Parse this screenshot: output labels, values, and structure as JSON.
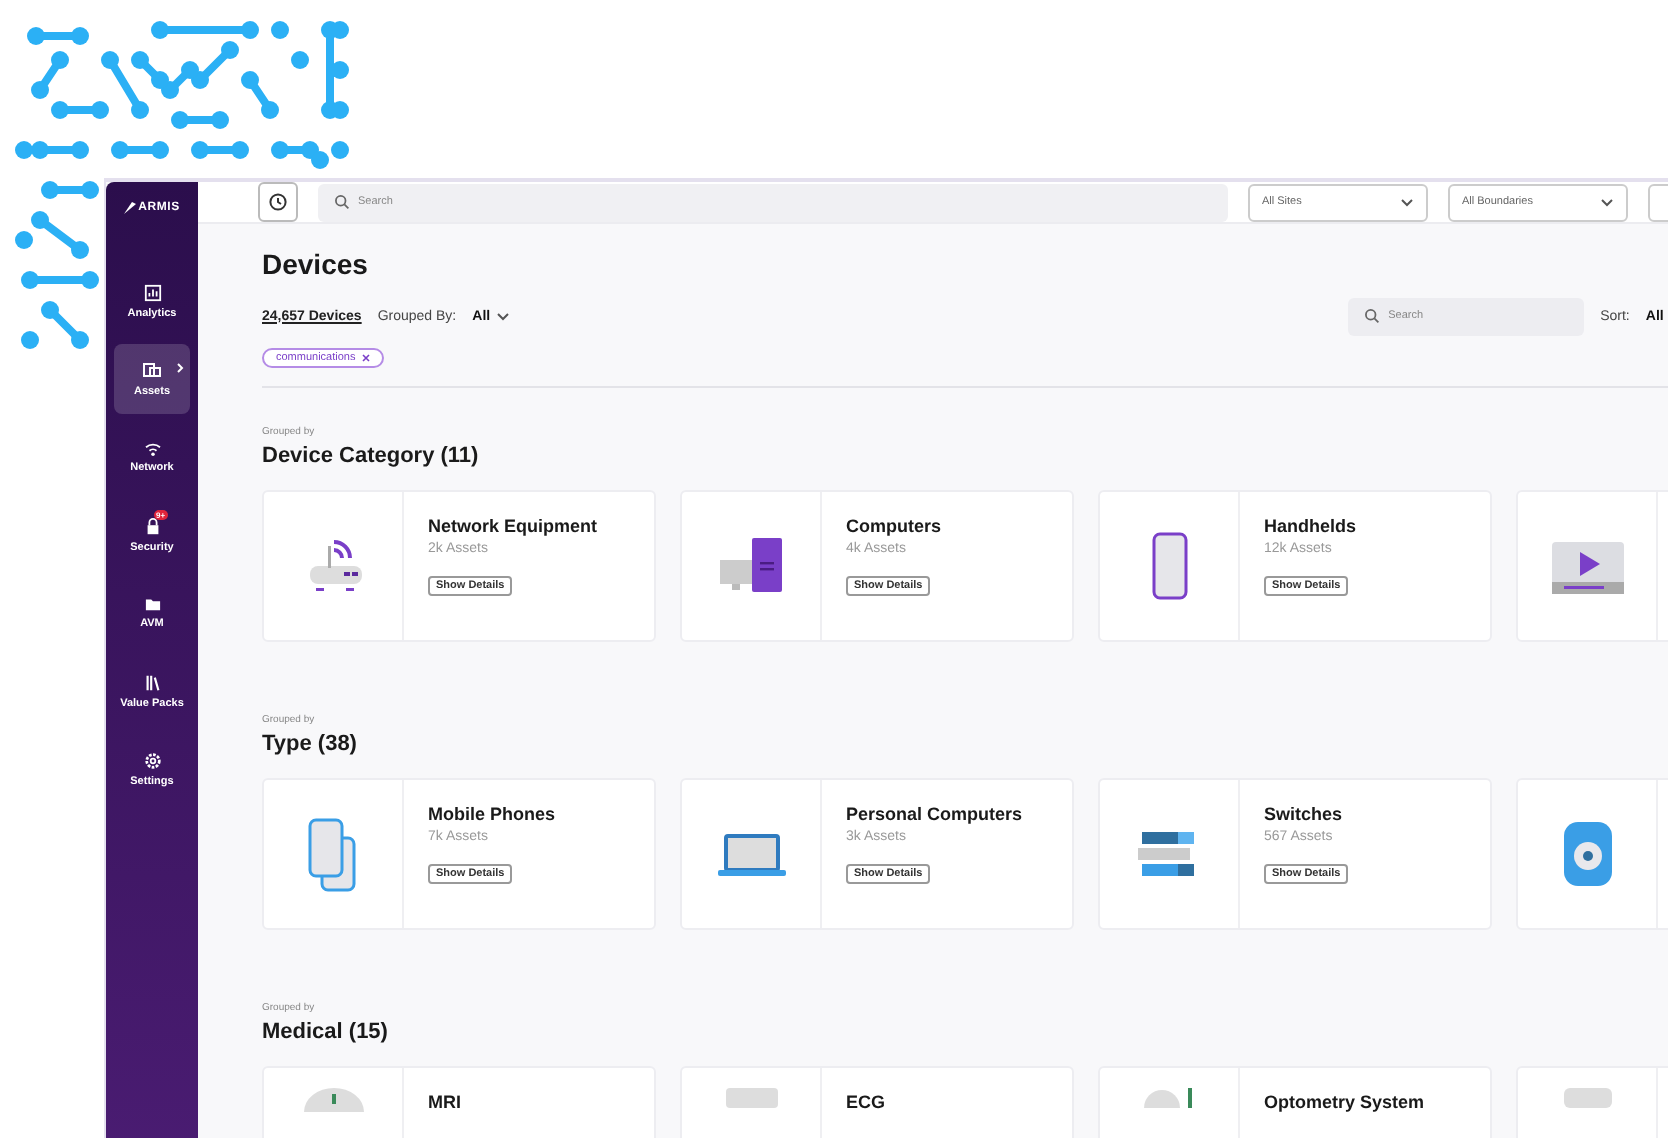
{
  "sidebar": {
    "logo": "ARMIS",
    "items": [
      {
        "label": "Analytics",
        "selected": false
      },
      {
        "label": "Assets",
        "selected": true,
        "expandable": true
      },
      {
        "label": "Network",
        "selected": false
      },
      {
        "label": "Security",
        "selected": false,
        "badge": "9+"
      },
      {
        "label": "AVM",
        "selected": false
      },
      {
        "label": "Value Packs",
        "selected": false
      },
      {
        "label": "Settings",
        "selected": false
      }
    ]
  },
  "topbar": {
    "search": {
      "placeholder": "Search"
    },
    "filters": [
      "All Sites",
      "All Boundaries"
    ]
  },
  "page": {
    "title": "Devices",
    "count": "24,657 Devices",
    "grouped_by_label": "Grouped By:",
    "grouped_by_value": "All",
    "search": {
      "placeholder": "Search"
    },
    "sort_label": "Sort:",
    "sort_value": "All",
    "chips": [
      "communications"
    ]
  },
  "sections": [
    {
      "caption": "Grouped by",
      "title": "Device Category (11)",
      "cards": [
        {
          "title": "Network Equipment",
          "assets": "2k Assets",
          "button": "Show Details"
        },
        {
          "title": "Computers",
          "assets": "4k Assets",
          "button": "Show Details"
        },
        {
          "title": "Handhelds",
          "assets": "12k Assets",
          "button": "Show Details"
        }
      ],
      "more_cards": true
    },
    {
      "caption": "Grouped by",
      "title": "Type (38)",
      "cards": [
        {
          "title": "Mobile Phones",
          "assets": "7k Assets",
          "button": "Show Details"
        },
        {
          "title": "Personal Computers",
          "assets": "3k Assets",
          "button": "Show Details"
        },
        {
          "title": "Switches",
          "assets": "567 Assets",
          "button": "Show Details"
        }
      ],
      "more_cards": true
    },
    {
      "caption": "Grouped by",
      "title": "Medical (15)",
      "cards": [
        {
          "title": "MRI"
        },
        {
          "title": "ECG"
        },
        {
          "title": "Optometry System"
        }
      ],
      "more_cards": true
    }
  ]
}
